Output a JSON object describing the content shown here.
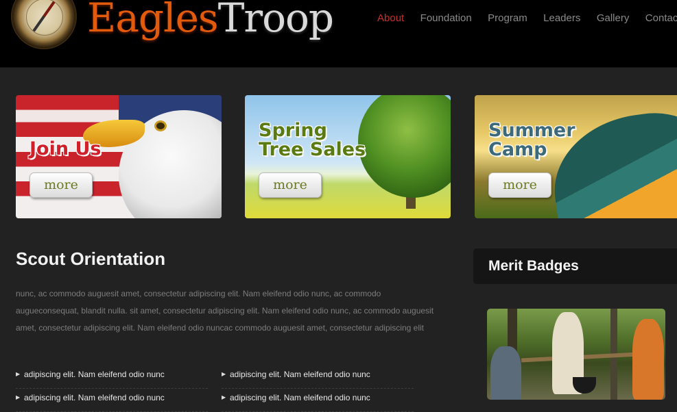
{
  "header": {
    "logo_word1": "Eagles",
    "logo_word2": "Troop",
    "nav": [
      {
        "label": "About",
        "active": true
      },
      {
        "label": "Foundation"
      },
      {
        "label": "Program"
      },
      {
        "label": "Leaders"
      },
      {
        "label": "Gallery"
      },
      {
        "label": "Contacts"
      }
    ]
  },
  "banners": [
    {
      "title": "Join Us",
      "button": "more"
    },
    {
      "title": "Spring\nTree Sales",
      "button": "more"
    },
    {
      "title": "Summer\nCamp",
      "button": "more"
    }
  ],
  "main": {
    "heading": "Scout Orientation",
    "paragraph": "nunc, ac commodo auguesit amet, consectetur adipiscing elit. Nam eleifend odio nunc, ac commodo augueconsequat, blandit nulla. sit amet, consectetur adipiscing elit. Nam eleifend odio nunc, ac commodo auguesit amet, consectetur adipiscing elit. Nam eleifend odio nuncac commodo auguesit amet, consectetur adipiscing elit",
    "list_left": [
      "adipiscing elit. Nam eleifend odio nunc",
      "adipiscing elit. Nam eleifend odio nunc"
    ],
    "list_right": [
      "adipiscing elit. Nam eleifend odio nunc",
      "adipiscing elit. Nam eleifend odio nunc"
    ]
  },
  "sidebar": {
    "heading": "Merit Badges"
  },
  "colors": {
    "accent_active": "#c8312a",
    "logo_orange": "#e25a0c",
    "background": "#222222"
  }
}
